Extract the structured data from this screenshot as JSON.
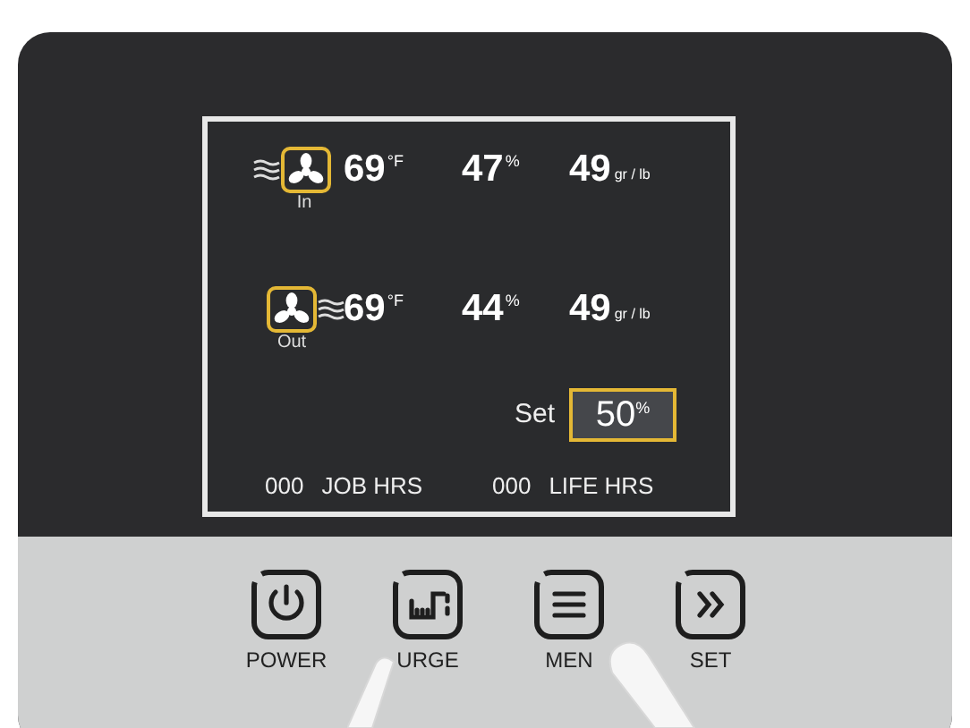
{
  "display": {
    "readings": [
      {
        "kind": "in",
        "label": "In",
        "temperature": "69",
        "temperature_unit": "°F",
        "humidity": "47",
        "humidity_unit": "%",
        "grains": "49",
        "grains_unit": "gr / lb"
      },
      {
        "kind": "out",
        "label": "Out",
        "temperature": "69",
        "temperature_unit": "°F",
        "humidity": "44",
        "humidity_unit": "%",
        "grains": "49",
        "grains_unit": "gr / lb"
      }
    ],
    "setpoint": {
      "label": "Set",
      "value": "50",
      "unit": "%"
    },
    "hours": [
      {
        "value": "000",
        "label": "JOB HRS"
      },
      {
        "value": "000",
        "label": "LIFE HRS"
      }
    ]
  },
  "buttons": [
    {
      "kind": "power",
      "label": "POWER"
    },
    {
      "kind": "purge",
      "label": "URGE"
    },
    {
      "kind": "menu",
      "label": "MEN"
    },
    {
      "kind": "set",
      "label": "SET"
    }
  ]
}
